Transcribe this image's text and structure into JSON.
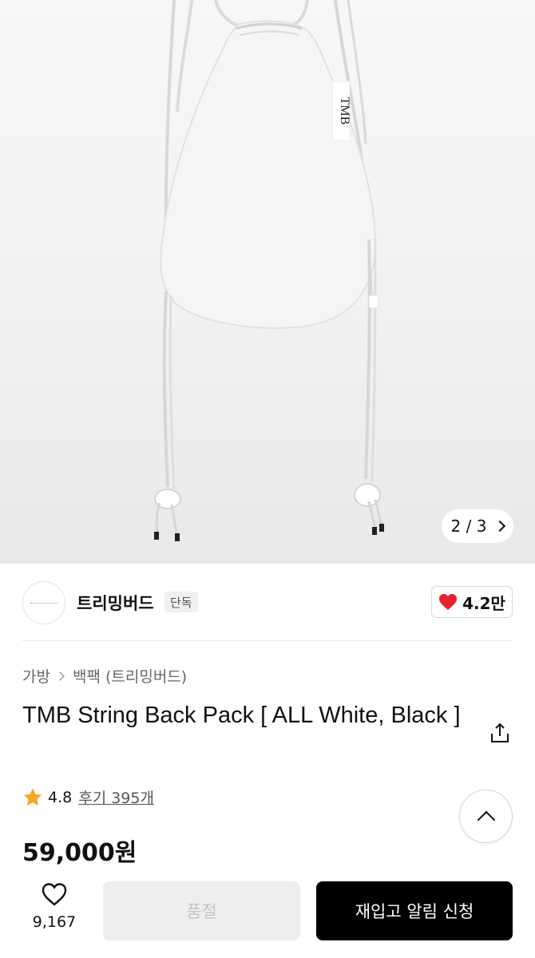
{
  "gallery": {
    "counter_current": "2",
    "counter_separator": "/",
    "counter_total": "3",
    "bag_tag_text": "TMB"
  },
  "seller": {
    "name": "트리밍버드",
    "badge": "단독",
    "likes": "4.2만"
  },
  "breadcrumb": {
    "category": "가방",
    "subcategory": "백팩 (트리밍버드)"
  },
  "product": {
    "title": "TMB String Back Pack [ ALL White, Black ]",
    "rating": "4.8",
    "reviews_label": "후기 395개",
    "price": "59,000원"
  },
  "bottom_bar": {
    "wish_count": "9,167",
    "soldout_label": "품절",
    "restock_label": "재입고 알림 신청"
  },
  "colors": {
    "heart": "#e8222e",
    "star": "#f5a623",
    "primary_button": "#000000"
  }
}
